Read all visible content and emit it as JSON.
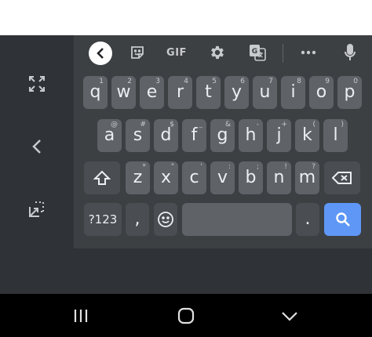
{
  "toolbar": {
    "gif_label": "GIF",
    "icons": [
      "chevron-left-icon",
      "sticker-icon",
      "gif-icon",
      "gear-icon",
      "translate-icon",
      "more-icon",
      "mic-icon"
    ]
  },
  "side_panel": {
    "icons": [
      "fullscreen-icon",
      "chevron-left-icon",
      "float-keyboard-icon"
    ]
  },
  "keys": {
    "row1": [
      {
        "ch": "q",
        "hint": "1"
      },
      {
        "ch": "w",
        "hint": "2"
      },
      {
        "ch": "e",
        "hint": "3"
      },
      {
        "ch": "r",
        "hint": "4"
      },
      {
        "ch": "t",
        "hint": "5"
      },
      {
        "ch": "y",
        "hint": "6"
      },
      {
        "ch": "u",
        "hint": "7"
      },
      {
        "ch": "i",
        "hint": "8"
      },
      {
        "ch": "o",
        "hint": "9"
      },
      {
        "ch": "p",
        "hint": "0"
      }
    ],
    "row2": [
      {
        "ch": "a",
        "hint": "@"
      },
      {
        "ch": "s",
        "hint": "#"
      },
      {
        "ch": "d",
        "hint": "$"
      },
      {
        "ch": "f",
        "hint": "_"
      },
      {
        "ch": "g",
        "hint": "&"
      },
      {
        "ch": "h",
        "hint": "-"
      },
      {
        "ch": "j",
        "hint": "+"
      },
      {
        "ch": "k",
        "hint": "("
      },
      {
        "ch": "l",
        "hint": ")"
      }
    ],
    "row3": [
      {
        "ch": "z",
        "hint": "*"
      },
      {
        "ch": "x",
        "hint": "\""
      },
      {
        "ch": "c",
        "hint": "'"
      },
      {
        "ch": "v",
        "hint": ":"
      },
      {
        "ch": "b",
        "hint": ";"
      },
      {
        "ch": "n",
        "hint": "!"
      },
      {
        "ch": "m",
        "hint": "?"
      }
    ],
    "symbols_label": "?123",
    "comma": ",",
    "period": "."
  },
  "colors": {
    "key": "#5f6368",
    "function_key": "#4a4e52",
    "action_key": "#5e97f6",
    "keyboard_bg": "#3c4043"
  }
}
